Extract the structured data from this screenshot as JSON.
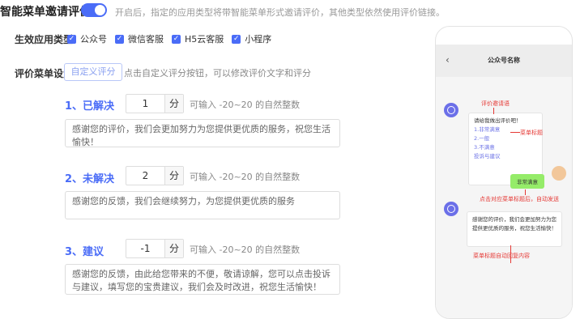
{
  "header": {
    "title": "智能菜单邀请评价",
    "toggle_on": true,
    "description": "开启后，指定的应用类型将带智能菜单形式邀请评价，其他类型依然使用评价链接。"
  },
  "apply_types": {
    "label": "生效应用类型",
    "options": [
      {
        "label": "公众号",
        "checked": true
      },
      {
        "label": "微信客服",
        "checked": true
      },
      {
        "label": "H5云客服",
        "checked": true
      },
      {
        "label": "小程序",
        "checked": true
      }
    ]
  },
  "menu_settings": {
    "label": "评价菜单设置",
    "custom_button": "自定义评分",
    "hint": "点击自定义评分按钮，可以修改评价文字和评分"
  },
  "sections": [
    {
      "title": "1、已解决",
      "score": "1",
      "unit": "分",
      "range_hint": "可输入 -20~20 的自然整数",
      "message": "感谢您的评价，我们会更加努力为您提供更优质的服务，祝您生活愉快！"
    },
    {
      "title": "2、未解决",
      "score": "2",
      "unit": "分",
      "range_hint": "可输入 -20~20 的自然整数",
      "message": "感谢您的反馈，我们会继续努力，为您提供更优质的服务"
    },
    {
      "title": "3、建议",
      "score": "-1",
      "unit": "分",
      "range_hint": "可输入 -20~20 的自然整数",
      "message": "感谢您的反馈，由此给您带来的不便，敬请谅解，您可以点击投诉与建议，填写您的宝贵建议，我们会及时改进，祝您生活愉快！"
    }
  ],
  "phone": {
    "nav_title": "公众号名称",
    "back_icon": "chevron-left-icon",
    "bubble1": {
      "prompt": "请给我做出评价吧！",
      "items": [
        "1.非常满意",
        "2.一般",
        "3.不满意",
        "投诉与建议"
      ]
    },
    "user_reply": "非常满意",
    "bubble2": "感谢您的评价，我们会更加努力为您提供更优质的服务，祝您生活愉快！",
    "annotations": {
      "invite": "评价邀请语",
      "menu_title": "菜单标题",
      "auto_send": "点击对应菜单标题后，自动发送",
      "auto_reply": "菜单标题自动回复内容"
    }
  },
  "colors": {
    "accent": "#4a6cf7",
    "annotation": "#e53935",
    "user_bubble": "#95ec69"
  }
}
